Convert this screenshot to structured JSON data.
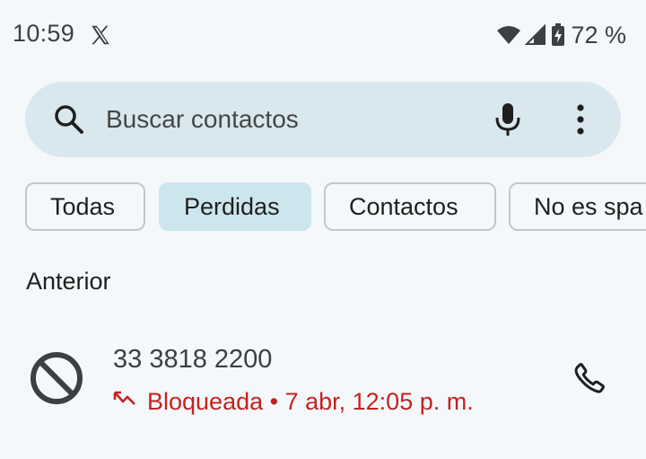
{
  "status_bar": {
    "time": "10:59",
    "battery": "72 %",
    "icons": [
      "x-logo-icon",
      "wifi-icon",
      "signal-icon",
      "battery-charging-icon"
    ]
  },
  "search": {
    "placeholder": "Buscar contactos",
    "value": "",
    "icons": [
      "search-icon",
      "mic-icon",
      "more-vert-icon"
    ]
  },
  "filters": {
    "chips": [
      {
        "label": "Todas",
        "selected": false
      },
      {
        "label": "Perdidas",
        "selected": true
      },
      {
        "label": "Contactos",
        "selected": false
      },
      {
        "label": "No es spa",
        "selected": false
      }
    ]
  },
  "section": {
    "heading": "Anterior"
  },
  "calls": [
    {
      "number": "33 3818 2200",
      "status": "Bloqueada",
      "separator": " • ",
      "time": "7 abr, 12:05 p. m.",
      "status_color": "#c5221f"
    }
  ],
  "colors": {
    "background": "#f4f8fb",
    "search_bg": "#d9e8ee",
    "chip_selected_bg": "#cde6ee",
    "missed_red": "#c5221f"
  }
}
